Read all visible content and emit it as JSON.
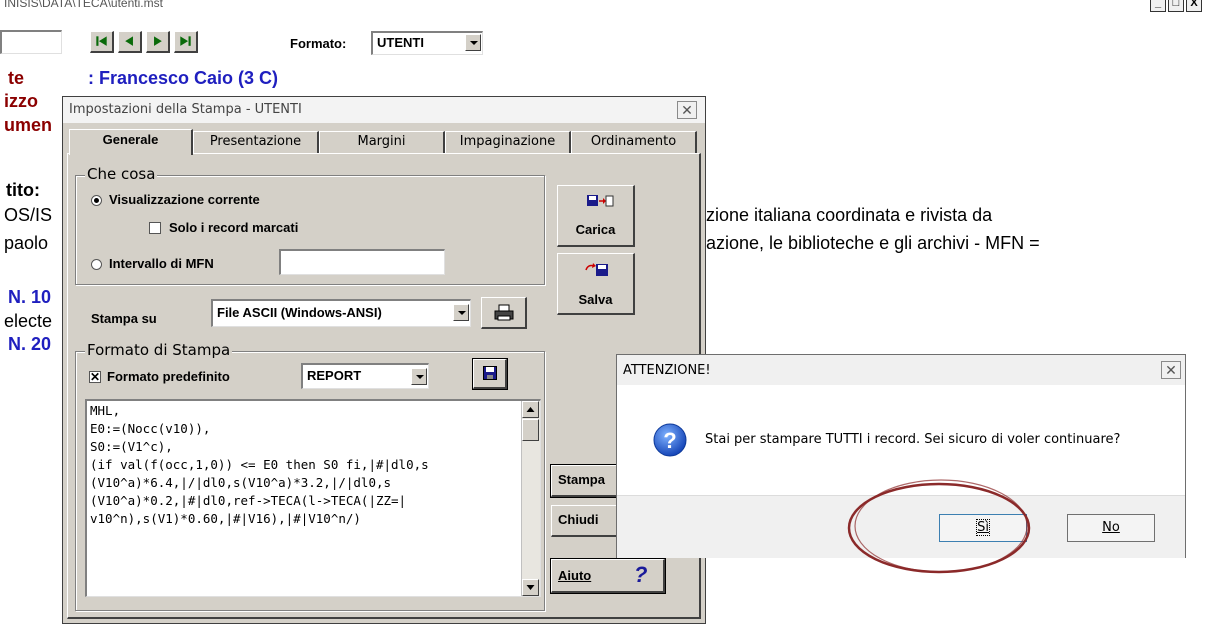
{
  "window": {
    "title_path": "INISIS\\DATA\\TECA\\utenti.mst",
    "controls": [
      "_",
      "□",
      "X"
    ]
  },
  "toolbar": {
    "formato_label": "Formato:",
    "formato_value": "UTENTI"
  },
  "record": {
    "utente_label": "te",
    "utente_value": ": Francesco Caio (3 C)",
    "indirizzo_label": "izzo",
    "documento_label": "umen",
    "titolo_label": "tito:",
    "line1_left": "OS/IS",
    "line1_right": "zione italiana coordinata e rivista da",
    "line2_left": "paolo",
    "line2_right": "azione, le biblioteche e gli archivi - MFN =",
    "n1": "N. 10",
    "selected": "electe",
    "n2": "N. 20"
  },
  "print_dialog": {
    "title": "Impostazioni della Stampa - UTENTI",
    "tabs": [
      "Generale",
      "Presentazione",
      "Margini",
      "Impaginazione",
      "Ordinamento"
    ],
    "che_cosa": "Che cosa",
    "option_current": "Visualizzazione corrente",
    "option_marked": "Solo i record marcati",
    "option_range": "Intervallo di MFN",
    "stampa_su_label": "Stampa su",
    "stampa_su_value": "File ASCII (Windows-ANSI)",
    "formato_group": "Formato di Stampa",
    "formato_predefinito": "Formato predefinito",
    "formato_value": "REPORT",
    "format_code": "MHL,\nE0:=(Nocc(v10)),\nS0:=(V1^c),\n(if val(f(occ,1,0)) <= E0 then S0 fi,|#|dl0,s\n(V10^a)*6.4,|/|dl0,s(V10^a)*3.2,|/|dl0,s\n(V10^a)*0.2,|#|dl0,ref->TECA(l->TECA(|ZZ=|\nv10^n),s(V1)*0.60,|#|V16),|#|V10^n/)",
    "carica": "Carica",
    "salva": "Salva",
    "stampa": "Stampa",
    "chiudi": "Chiudi",
    "aiuto": "Aiuto",
    "aiuto_q": "?"
  },
  "warning": {
    "title": "ATTENZIONE!",
    "message": "Stai per stampare TUTTI i record. Sei sicuro di voler continuare?",
    "yes": "Sì",
    "no": "No"
  },
  "colors": {
    "highlight_circle": "#8b2a2a",
    "record_label": "#8b0000",
    "record_value": "#1f1fbf"
  }
}
